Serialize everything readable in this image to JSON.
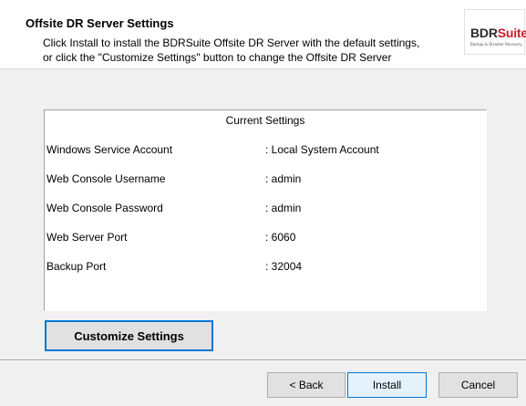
{
  "header": {
    "title": "Offsite DR Server Settings",
    "description_line1": "Click Install to install the BDRSuite Offsite DR Server with the default settings,",
    "description_line2": "or click the \"Customize Settings\" button to change the Offsite DR Server",
    "logo_text_primary": "BDR",
    "logo_text_secondary": "Suite",
    "logo_tagline": "Backup & Disaster Recovery"
  },
  "settings": {
    "title": "Current Settings",
    "rows": [
      {
        "label": "Windows Service Account",
        "value": ": Local System Account"
      },
      {
        "label": "Web Console Username",
        "value": ": admin"
      },
      {
        "label": "Web Console Password",
        "value": ": admin"
      },
      {
        "label": "Web Server Port",
        "value": ": 6060"
      },
      {
        "label": "Backup Port",
        "value": ": 32004"
      }
    ]
  },
  "buttons": {
    "customize": "Customize Settings",
    "back": "< Back",
    "install": "Install",
    "cancel": "Cancel"
  },
  "colors": {
    "focus_border": "#0078d7",
    "logo_accent": "#c8202a"
  }
}
